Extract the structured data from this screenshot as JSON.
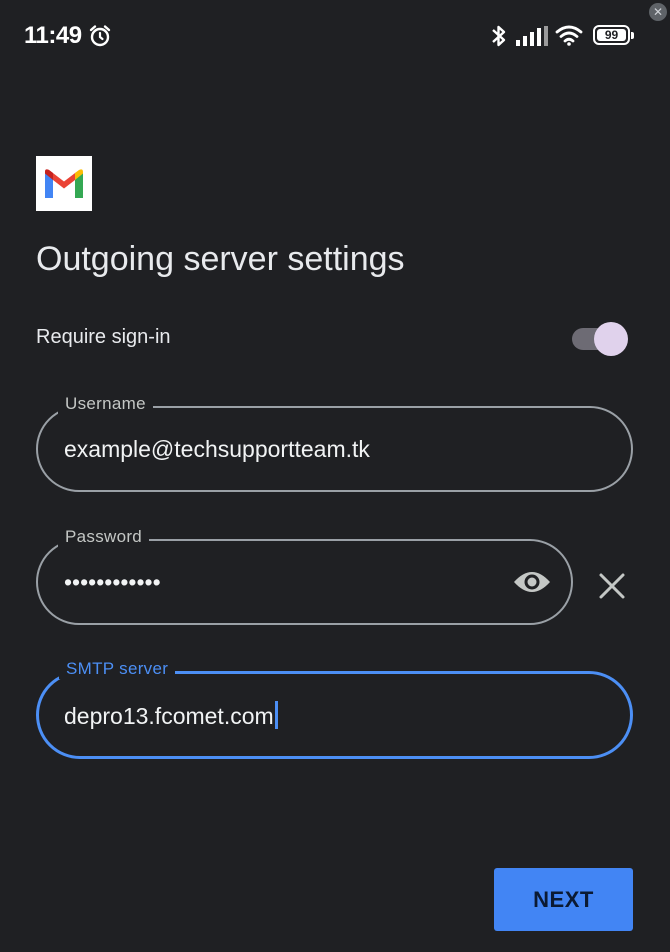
{
  "status_bar": {
    "time": "11:49",
    "battery_level": "99"
  },
  "page": {
    "title": "Outgoing server settings"
  },
  "require_signin": {
    "label": "Require sign-in",
    "enabled": true
  },
  "fields": {
    "username": {
      "label": "Username",
      "value": "example@techsupportteam.tk"
    },
    "password": {
      "label": "Password",
      "value": "••••••••••••"
    },
    "smtp_server": {
      "label": "SMTP server",
      "value": "depro13.fcomet.com"
    }
  },
  "actions": {
    "next_label": "NEXT"
  },
  "colors": {
    "background": "#1f2023",
    "accent": "#4285f4",
    "focus_outline": "#4c8ff5",
    "toggle_thumb": "#e0d2ec"
  },
  "icons": {
    "status": [
      "alarm-icon",
      "bluetooth-icon",
      "signal-icon",
      "wifi-icon",
      "battery-icon"
    ],
    "password_visibility": "eye-icon",
    "clear": "close-icon",
    "logo": "gmail-logo"
  }
}
